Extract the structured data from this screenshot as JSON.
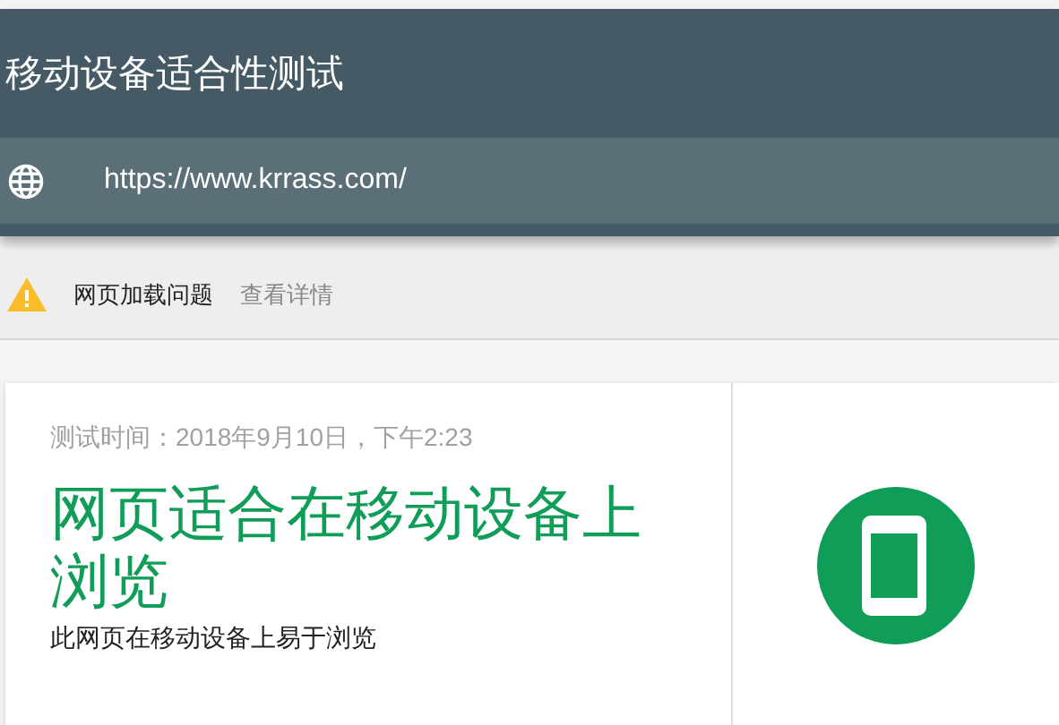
{
  "header": {
    "title": "移动设备适合性测试",
    "url": "https://www.krrass.com/"
  },
  "issue_bar": {
    "message": "网页加载问题",
    "link": "查看详情"
  },
  "result": {
    "tested_at": "测试时间：2018年9月10日，下午2:23",
    "verdict": "网页适合在移动设备上浏览",
    "detail": "此网页在移动设备上易于浏览",
    "mobile_friendly": true
  }
}
